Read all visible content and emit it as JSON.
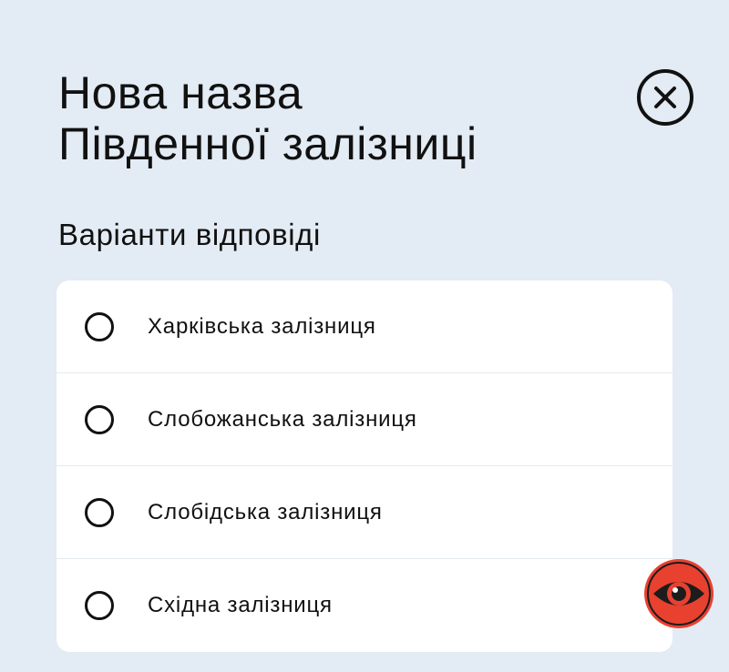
{
  "header": {
    "title_line1": "Нова назва",
    "title_line2": "Південної залізниці",
    "close_icon": "close-circle-x"
  },
  "question": {
    "subtitle": "Варіанти відповіді"
  },
  "options": [
    {
      "label": "Харківська залізниця",
      "selected": false
    },
    {
      "label": "Слобожанська залізниця",
      "selected": false
    },
    {
      "label": "Слобідська залізниця",
      "selected": false
    },
    {
      "label": "Східна залізниця",
      "selected": false
    }
  ],
  "logo": {
    "icon": "eye-logo",
    "colors": {
      "ring": "#e8412f",
      "eye": "#1c1c1c",
      "pupil": "#e8412f"
    }
  },
  "colors": {
    "background": "#e3ebf4",
    "card": "#ffffff",
    "text": "#111111",
    "divider": "#e3e9ef"
  }
}
